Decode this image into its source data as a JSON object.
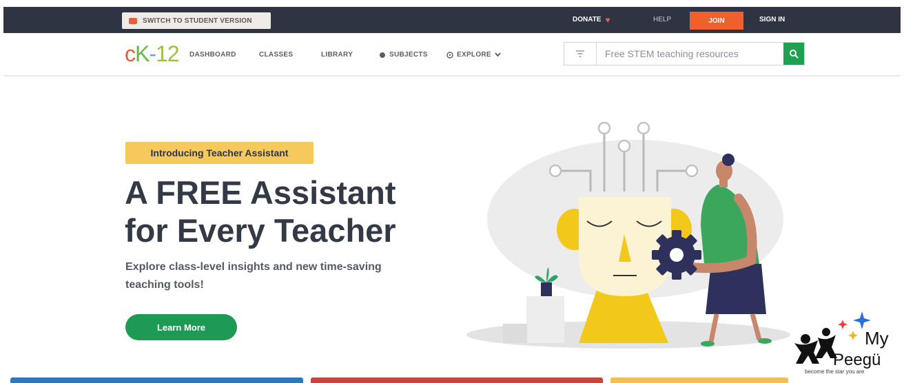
{
  "topbar": {
    "student_version": "SWITCH TO STUDENT VERSION",
    "donate": "DONATE",
    "help": "HELP",
    "join": "JOIN",
    "sign_in": "SIGN IN"
  },
  "logo": {
    "c": "c",
    "k": "K",
    "dash": "-",
    "num": "12"
  },
  "nav": {
    "dashboard": "DASHBOARD",
    "classes": "CLASSES",
    "library": "LIBRARY",
    "subjects": "SUBJECTS",
    "explore": "EXPLORE"
  },
  "search": {
    "placeholder": "Free STEM teaching resources"
  },
  "hero": {
    "badge": "Introducing Teacher Assistant",
    "title_line1": "A FREE Assistant",
    "title_line2": "for Every Teacher",
    "subtitle_line1": "Explore class-level insights and new time-saving",
    "subtitle_line2": "teaching tools!",
    "cta": "Learn More"
  },
  "peegu": {
    "my": "My",
    "name": "Peegü",
    "tagline": "become the star you are"
  },
  "colors": {
    "topbar": "#2e3441",
    "join": "#f0602c",
    "brand_green": "#1f9a55",
    "badge": "#f5c95c",
    "tile_blue": "#2f77bd",
    "tile_red": "#c8453e",
    "tile_yellow": "#f1be5a"
  }
}
